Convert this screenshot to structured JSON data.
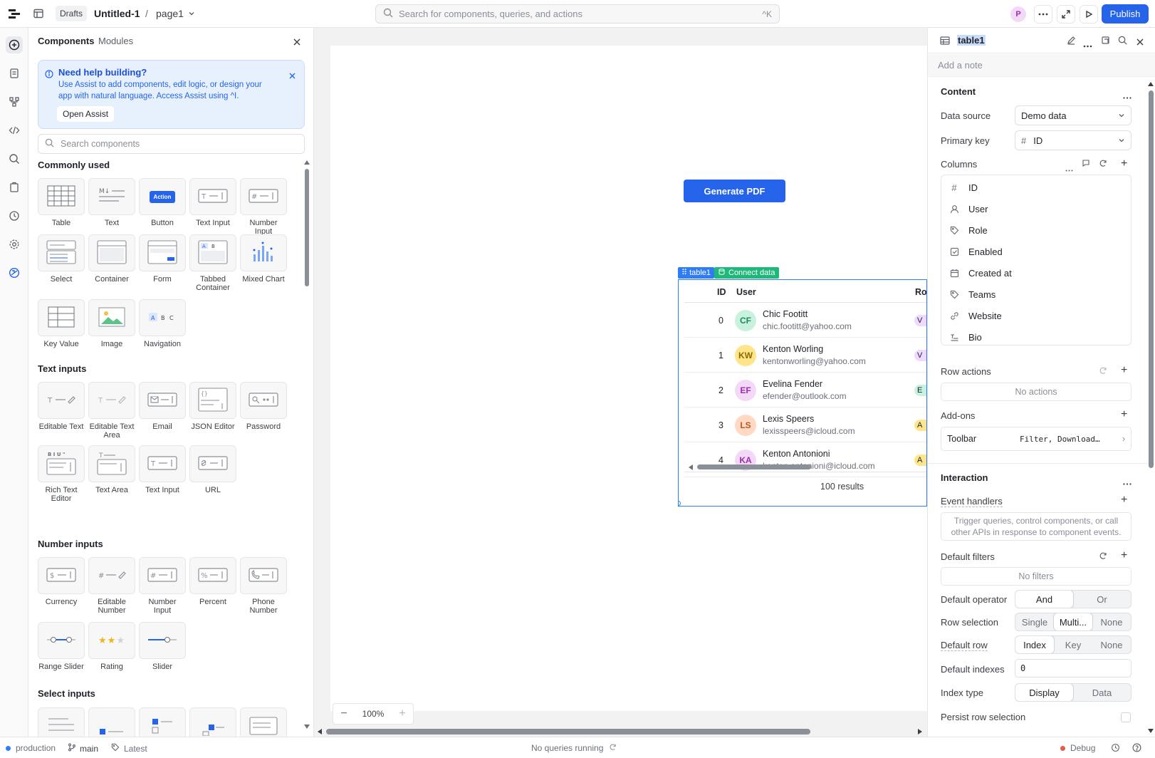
{
  "topbar": {
    "drafts": "Drafts",
    "app_name": "Untitled-1",
    "sep": "/",
    "page": "page1",
    "search_placeholder": "Search for components, queries, and actions",
    "search_shortcut": "^K",
    "avatar_initial": "P",
    "publish": "Publish"
  },
  "components": {
    "tabs": [
      "Components",
      "Modules"
    ],
    "help": {
      "title": "Need help building?",
      "body": "Use Assist to add components, edit logic, or design your app with natural language. Access Assist using ^I.",
      "button": "Open Assist"
    },
    "search_placeholder": "Search components",
    "sections": [
      {
        "title": "Commonly used",
        "items": [
          "Table",
          "Text",
          "Button",
          "Text Input",
          "Number Input",
          "Select",
          "Container",
          "Form",
          "Tabbed Container",
          "Mixed Chart",
          "Key Value",
          "Image",
          "Navigation"
        ]
      },
      {
        "title": "Text inputs",
        "items": [
          "Editable Text",
          "Editable Text Area",
          "Email",
          "JSON Editor",
          "Password",
          "Rich Text Editor",
          "Text Area",
          "Text Input",
          "URL"
        ]
      },
      {
        "title": "Number inputs",
        "items": [
          "Currency",
          "Editable Number",
          "Number Input",
          "Percent",
          "Phone Number",
          "Range Slider",
          "Rating",
          "Slider"
        ]
      },
      {
        "title": "Select inputs",
        "items": []
      }
    ],
    "button_tile_text": "Action"
  },
  "canvas": {
    "generate_pdf": "Generate PDF",
    "table_tag": "table1",
    "connect_data": "Connect data",
    "zoom": "100%",
    "table": {
      "headers": [
        "ID",
        "User",
        "Rol"
      ],
      "rows": [
        {
          "id": "0",
          "initials": "CF",
          "name": "Chic Footitt",
          "email": "chic.footitt@yahoo.com",
          "role": "V",
          "color": "#c8f2dd",
          "text": "#1f8a5a",
          "role_color": "#efd9ff"
        },
        {
          "id": "1",
          "initials": "KW",
          "name": "Kenton Worling",
          "email": "kentonworling@yahoo.com",
          "role": "V",
          "color": "#ffe58a",
          "text": "#8a6a00",
          "role_color": "#efd9ff"
        },
        {
          "id": "2",
          "initials": "EF",
          "name": "Evelina Fender",
          "email": "efender@outlook.com",
          "role": "E",
          "color": "#f3d9f7",
          "text": "#9b2fae",
          "role_color": "#c8f2dd"
        },
        {
          "id": "3",
          "initials": "LS",
          "name": "Lexis Speers",
          "email": "lexisspeers@icloud.com",
          "role": "A",
          "color": "#ffd9c4",
          "text": "#b35a20",
          "role_color": "#ffe58a"
        },
        {
          "id": "4",
          "initials": "KA",
          "name": "Kenton Antonioni",
          "email": "kenton.antonioni@icloud.com",
          "role": "A",
          "color": "#f3d9f7",
          "text": "#9b2fae",
          "role_color": "#ffe58a"
        }
      ],
      "results": "100 results"
    }
  },
  "inspector": {
    "name": "table1",
    "note_placeholder": "Add a note",
    "content_title": "Content",
    "data_source_label": "Data source",
    "data_source": "Demo data",
    "primary_key_label": "Primary key",
    "primary_key": "ID",
    "columns_label": "Columns",
    "columns": [
      "ID",
      "User",
      "Role",
      "Enabled",
      "Created at",
      "Teams",
      "Website",
      "Bio"
    ],
    "row_actions_label": "Row actions",
    "no_actions": "No actions",
    "addons_label": "Add-ons",
    "toolbar_label": "Toolbar",
    "toolbar_value": "Filter, Download…",
    "interaction_title": "Interaction",
    "event_handlers_label": "Event handlers",
    "event_handlers_hint": "Trigger queries, control components, or call other APIs in response to component events.",
    "default_filters_label": "Default filters",
    "no_filters": "No filters",
    "default_operator_label": "Default operator",
    "default_operator_options": [
      "And",
      "Or"
    ],
    "row_selection_label": "Row selection",
    "row_selection_options": [
      "Single",
      "Multi...",
      "None"
    ],
    "default_row_label": "Default row",
    "default_row_options": [
      "Index",
      "Key",
      "None"
    ],
    "default_indexes_label": "Default indexes",
    "default_indexes_value": "0",
    "index_type_label": "Index type",
    "index_type_options": [
      "Display",
      "Data"
    ],
    "persist_label": "Persist row selection"
  },
  "status": {
    "env": "production",
    "branch": "main",
    "version": "Latest",
    "queries": "No queries running",
    "debug": "Debug"
  },
  "colors": {
    "accent": "#2563eb",
    "green_tag": "#1db87a"
  }
}
